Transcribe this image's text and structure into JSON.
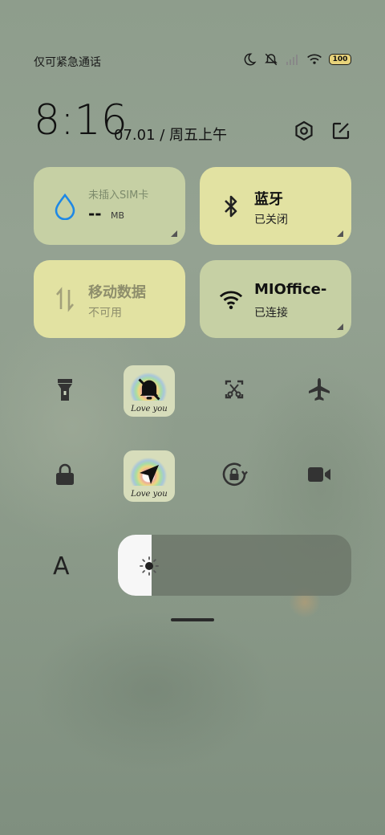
{
  "status_bar": {
    "carrier_text": "仅可紧急通话",
    "battery_level": "100",
    "icons": [
      "moon-icon",
      "vibrate-off-icon",
      "signal-icon",
      "wifi-icon",
      "battery-icon"
    ]
  },
  "clock": {
    "time": "8:16",
    "date": "07.01 / 周五上午",
    "actions": [
      "settings-icon",
      "edit-icon"
    ]
  },
  "tiles": {
    "sim": {
      "title": "未插入SIM卡",
      "value": "--",
      "unit": "MB",
      "icon": "water-drop-icon"
    },
    "bluetooth": {
      "title": "蓝牙",
      "status": "已关闭",
      "icon": "bluetooth-icon"
    },
    "mobile_data": {
      "title": "移动数据",
      "status": "不可用",
      "icon": "data-arrows-icon"
    },
    "wifi": {
      "title": "MIOffice-",
      "status": "已连接",
      "icon": "wifi-icon"
    }
  },
  "quick_toggles": {
    "row1": [
      "flashlight-icon",
      "mute-bell-icon",
      "screenshot-icon",
      "airplane-icon"
    ],
    "row2": [
      "lock-icon",
      "location-icon",
      "rotation-lock-icon",
      "video-camera-icon"
    ],
    "active_caption": "Love you"
  },
  "brightness": {
    "level_fraction": 0.145,
    "font_button_label": "A"
  },
  "colors": {
    "tile_green": "#c6d0a4",
    "tile_yellow": "#e2e2a2",
    "background": "#8e9d8c"
  }
}
